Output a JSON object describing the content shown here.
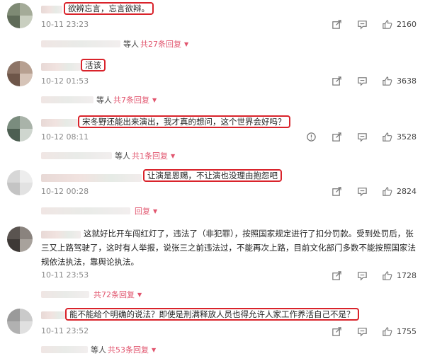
{
  "colors": {
    "highlight": "#d9232b",
    "reply_link": "#e1556e",
    "timestamp": "#8a8a8a"
  },
  "icons": {
    "share": "share-icon",
    "comment": "comment-icon",
    "like": "thumbs-up-icon",
    "report": "report-icon"
  },
  "comments": [
    {
      "text": "欲辨忘言，忘言欲辩。",
      "time": "10-11 23:23",
      "likes": "2160",
      "reply_prefix": "等人",
      "reply_link": "共27条回复"
    },
    {
      "text": "活该",
      "time": "10-12 01:53",
      "likes": "3638",
      "reply_prefix": "等人",
      "reply_link": "共7条回复"
    },
    {
      "text": "宋冬野还能出来演出，我才真的想问，这个世界会好吗？",
      "time": "10-12 08:11",
      "likes": "3528",
      "reply_prefix": "等人",
      "reply_link": "共1条回复"
    },
    {
      "text": "让演是恩赐，不让演也没理由抱怨吧",
      "time": "10-12 00:28",
      "likes": "2824",
      "reply_prefix": "",
      "reply_link": "回复"
    },
    {
      "text": "这就好比开车闯红灯了，违法了（非犯罪），按照国家规定进行了扣分罚款。受到处罚后，张三又上路驾驶了，这时有人举报，说张三之前违法过，不能再次上路，目前文化部门多数不能按照国家法规依法执法，靠舆论执法。",
      "time": "10-11 23:53",
      "likes": "1728",
      "reply_prefix": "",
      "reply_link": "共72条回复"
    },
    {
      "text": "能不能给个明确的说法？即使是刑满释放人员也得允许人家工作养活自己不是？",
      "time": "10-11 23:52",
      "likes": "1755",
      "reply_prefix": "等人",
      "reply_link": "共53条回复"
    }
  ]
}
